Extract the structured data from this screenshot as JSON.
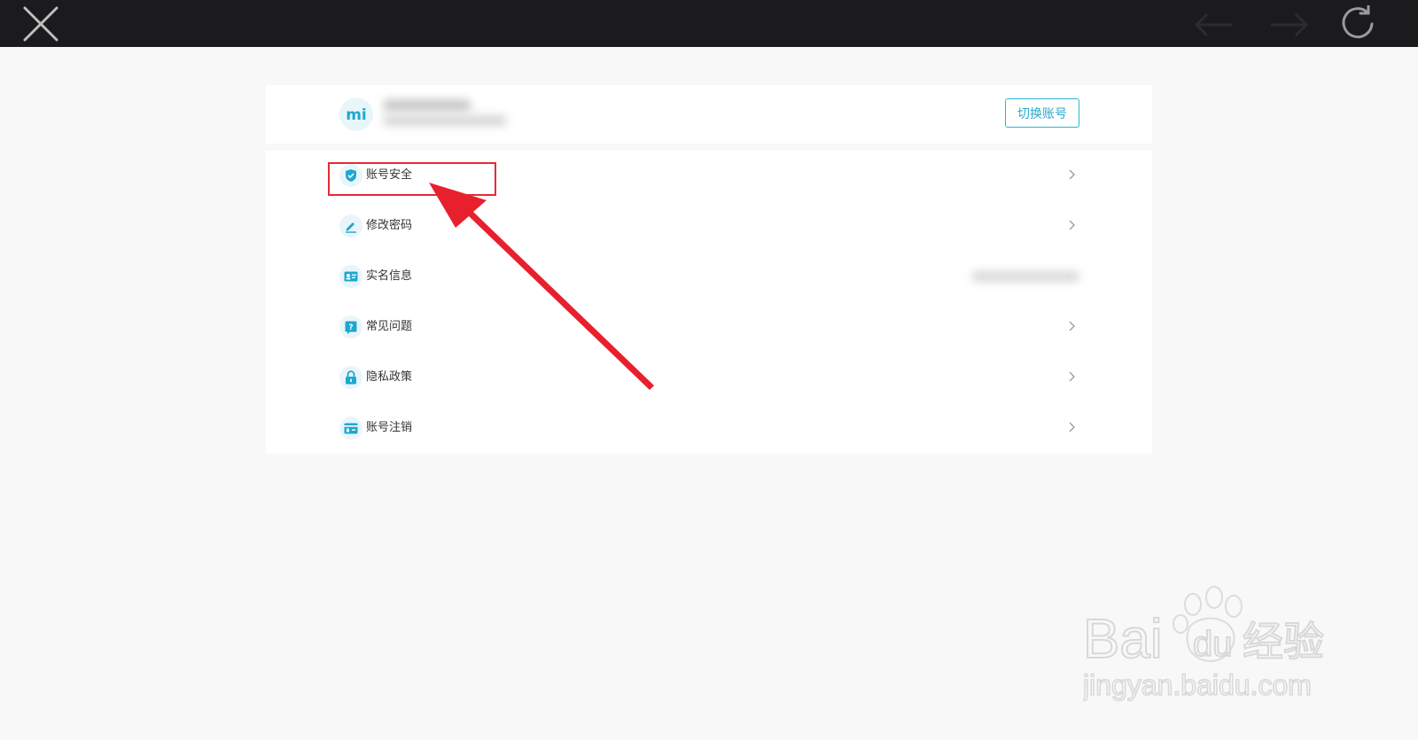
{
  "toolbar": {
    "close_icon": "close-icon",
    "back_icon": "arrow-left-icon",
    "forward_icon": "arrow-right-icon",
    "refresh_icon": "refresh-icon"
  },
  "account": {
    "avatar_text": "mi",
    "switch_label": "切换账号"
  },
  "menu": {
    "items": [
      {
        "label": "账号安全",
        "icon": "shield-icon"
      },
      {
        "label": "修改密码",
        "icon": "pencil-icon"
      },
      {
        "label": "实名信息",
        "icon": "id-card-icon"
      },
      {
        "label": "常见问题",
        "icon": "question-icon"
      },
      {
        "label": "隐私政策",
        "icon": "lock-icon"
      },
      {
        "label": "账号注销",
        "icon": "cancel-account-icon"
      }
    ]
  },
  "watermark": {
    "brand_left": "Bai",
    "brand_mid": "du",
    "brand_right": "经验",
    "url": "jingyan.baidu.com"
  },
  "colors": {
    "accent": "#2bb4d6",
    "icon": "#1fa7cf",
    "highlight": "#e52a35",
    "topbar": "#1b1b1d"
  }
}
